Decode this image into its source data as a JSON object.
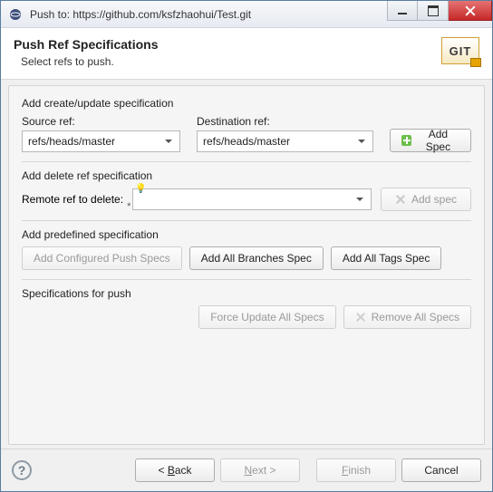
{
  "window": {
    "title": "Push to: https://github.com/ksfzhaohui/Test.git"
  },
  "header": {
    "title": "Push Ref Specifications",
    "subtitle": "Select refs to push.",
    "badge": "GIT"
  },
  "create_update": {
    "section": "Add create/update specification",
    "source_label": "Source ref:",
    "source_value": "refs/heads/master",
    "dest_label": "Destination ref:",
    "dest_value": "refs/heads/master",
    "add_btn": "Add Spec"
  },
  "delete_spec": {
    "section": "Add delete ref specification",
    "label": "Remote ref to delete:",
    "value": "",
    "add_btn": "Add spec"
  },
  "predefined": {
    "section": "Add predefined specification",
    "configured_btn": "Add Configured Push Specs",
    "branches_btn": "Add All Branches Spec",
    "tags_btn": "Add All Tags Spec"
  },
  "specs_for_push": {
    "section": "Specifications for push",
    "force_btn": "Force Update All Specs",
    "remove_btn": "Remove All Specs"
  },
  "footer": {
    "back_prefix": "< ",
    "back_letter": "B",
    "back_rest": "ack",
    "next_letter": "N",
    "next_rest": "ext >",
    "finish_letter": "F",
    "finish_rest": "inish",
    "cancel": "Cancel"
  }
}
